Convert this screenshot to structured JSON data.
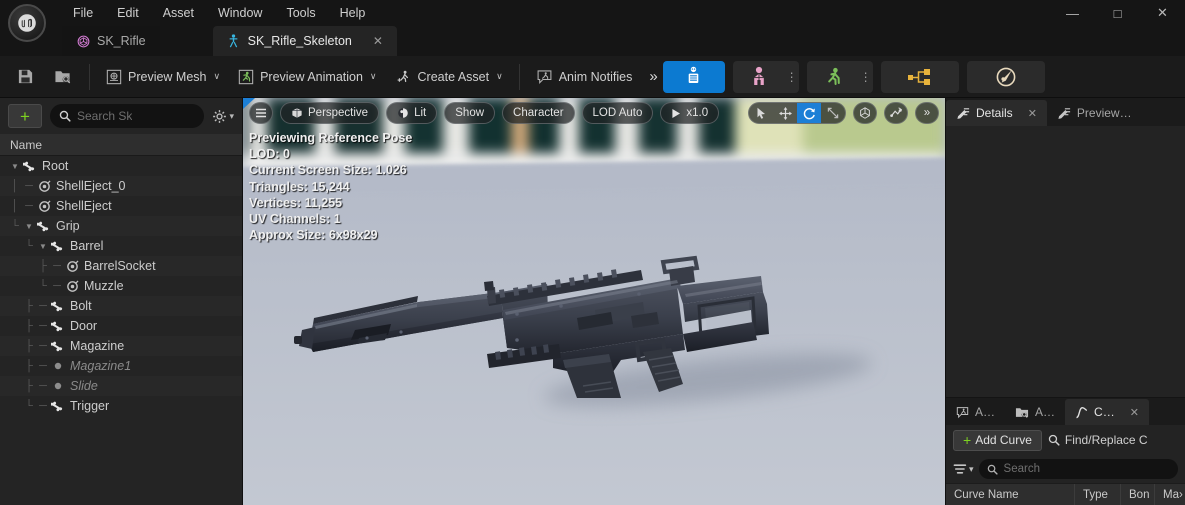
{
  "window": {
    "menus": [
      "File",
      "Edit",
      "Asset",
      "Window",
      "Tools",
      "Help"
    ],
    "controls": {
      "minimize": "—",
      "maximize": "□",
      "close": "✕"
    }
  },
  "tabs": [
    {
      "label": "SK_Rifle",
      "icon": "mesh-icon",
      "active": false
    },
    {
      "label": "SK_Rifle_Skeleton",
      "icon": "skeleton-icon",
      "active": true,
      "close": "✕"
    }
  ],
  "toolbar": {
    "save_icon": "save-icon",
    "browse_icon": "browse-content-icon",
    "preview_mesh": "Preview Mesh",
    "preview_animation": "Preview Animation",
    "create_asset": "Create Asset",
    "anim_notifies": "Anim Notifies",
    "overflow": "»",
    "caret": "∨",
    "modes": [
      {
        "name": "skeleton-mode",
        "active": true,
        "color": "#0c7ad1"
      },
      {
        "name": "mesh-mode",
        "active": false,
        "color": "#e8a3c8"
      },
      {
        "name": "animation-mode",
        "active": false,
        "color": "#7cbf5a"
      },
      {
        "name": "anim-blueprint-mode",
        "active": false,
        "color": "#e8b33c"
      },
      {
        "name": "physics-mode",
        "active": false,
        "color": "#e8d9bd"
      }
    ]
  },
  "skeleton_tree": {
    "add_label": "+",
    "search_placeholder": "Search Sk",
    "settings_icon": "gear-icon",
    "column_header": "Name",
    "items": [
      {
        "label": "Root",
        "depth": 0,
        "type": "bone",
        "expander": "▼"
      },
      {
        "label": "ShellEject_0",
        "depth": 1,
        "type": "socket",
        "expander": ""
      },
      {
        "label": "ShellEject",
        "depth": 1,
        "type": "socket",
        "expander": ""
      },
      {
        "label": "Grip",
        "depth": 1,
        "type": "bone",
        "expander": "▼"
      },
      {
        "label": "Barrel",
        "depth": 2,
        "type": "bone",
        "expander": "▼"
      },
      {
        "label": "BarrelSocket",
        "depth": 3,
        "type": "socket",
        "expander": ""
      },
      {
        "label": "Muzzle",
        "depth": 3,
        "type": "socket",
        "expander": ""
      },
      {
        "label": "Bolt",
        "depth": 2,
        "type": "bone",
        "expander": ""
      },
      {
        "label": "Door",
        "depth": 2,
        "type": "bone",
        "expander": ""
      },
      {
        "label": "Magazine",
        "depth": 2,
        "type": "bone",
        "expander": ""
      },
      {
        "label": "Magazine1",
        "depth": 2,
        "type": "virtual",
        "expander": ""
      },
      {
        "label": "Slide",
        "depth": 2,
        "type": "virtual",
        "expander": ""
      },
      {
        "label": "Trigger",
        "depth": 2,
        "type": "bone",
        "expander": ""
      }
    ]
  },
  "viewport": {
    "menu_icon": "hamburger-menu-icon",
    "view_mode": "Perspective",
    "lighting": "Lit",
    "show": "Show",
    "character": "Character",
    "lod": "LOD Auto",
    "play_speed": "x1.0",
    "overflow": "»",
    "transform_tools": [
      {
        "name": "select-tool",
        "active": false
      },
      {
        "name": "move-tool",
        "active": false
      },
      {
        "name": "rotate-tool",
        "active": true
      },
      {
        "name": "scale-tool",
        "active": false
      }
    ],
    "coord_icon": "coordinate-system-icon",
    "snap_icon": "surface-snap-icon",
    "stats": [
      "Previewing Reference Pose",
      "LOD: 0",
      "Current Screen Size: 1.026",
      "Triangles: 15,244",
      "Vertices: 11,255",
      "UV Channels: 1",
      "Approx Size: 6x98x29"
    ]
  },
  "details_panel": {
    "tabs": [
      {
        "label": "Details",
        "active": true,
        "close": "✕"
      },
      {
        "label": "Preview…",
        "active": false
      }
    ]
  },
  "curves_panel": {
    "tabs": [
      {
        "label": "A…",
        "icon": "anim-notifies-icon",
        "active": false
      },
      {
        "label": "A…",
        "icon": "asset-browser-icon",
        "active": false
      },
      {
        "label": "C…",
        "icon": "curve-icon",
        "active": true,
        "close": "✕"
      }
    ],
    "add_curve": "Add Curve",
    "find_replace": "Find/Replace C",
    "filter_icon": "filter-icon",
    "search_placeholder": "Search",
    "columns": [
      "Curve Name",
      "Type",
      "Bon",
      "Ma›"
    ]
  },
  "colors": {
    "accent_blue": "#0c7ad1",
    "green": "#7ed321",
    "panel_bg": "#242424",
    "titlebar_bg": "#151515",
    "viewport_floor": "#b9bfcc"
  }
}
